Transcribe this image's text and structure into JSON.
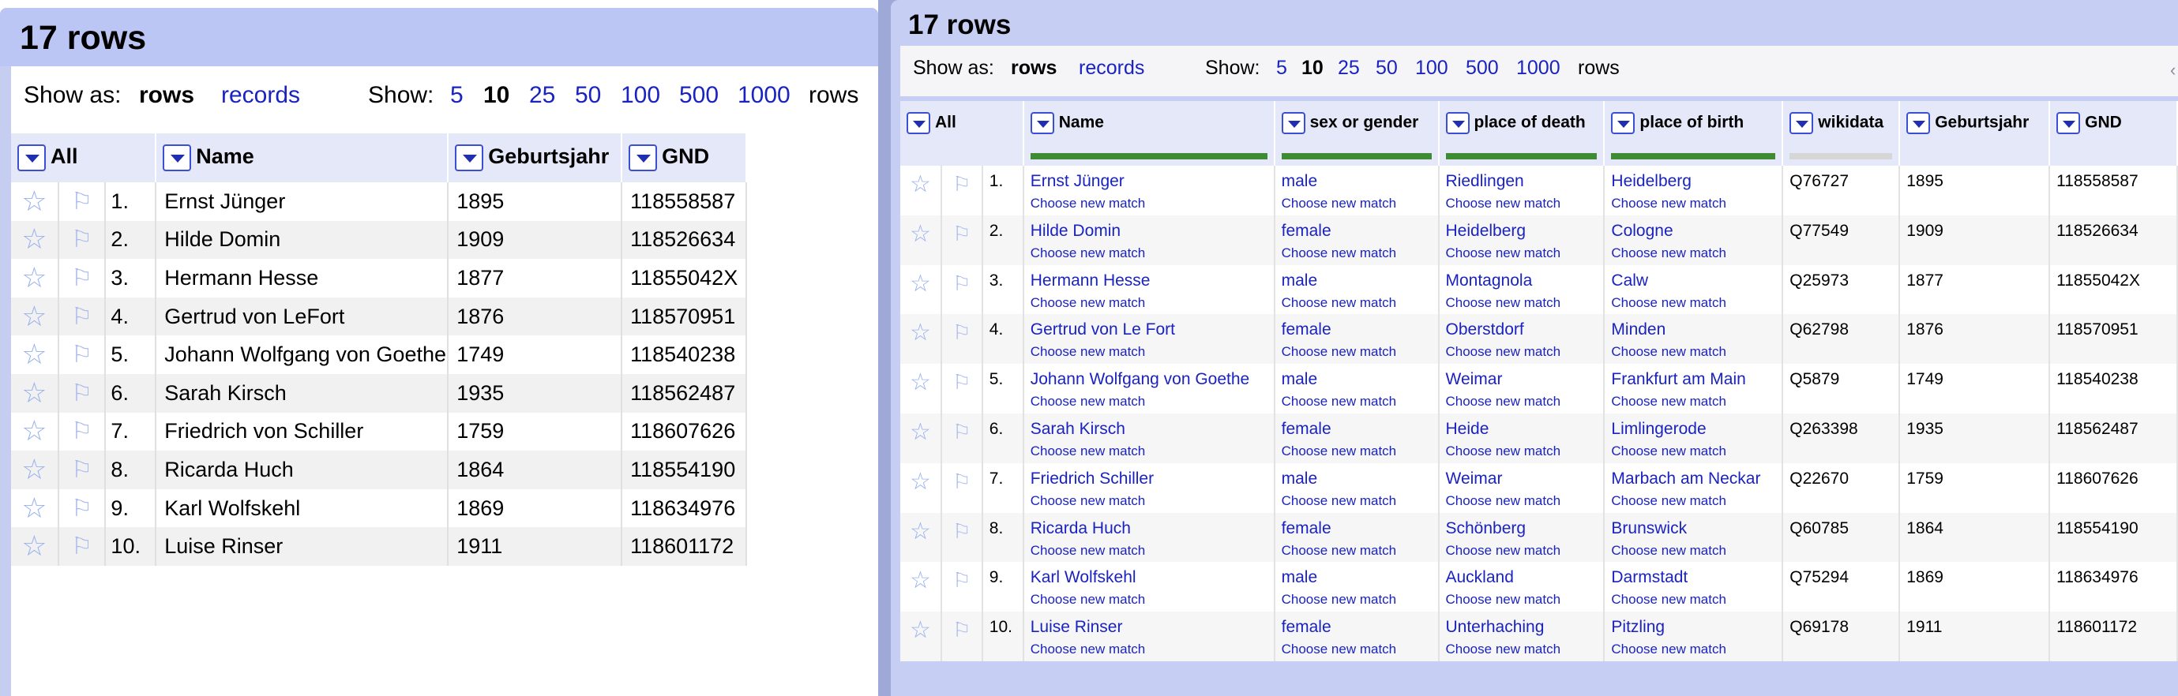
{
  "left": {
    "title": "17 rows",
    "show_as_label": "Show as:",
    "view_rows": "rows",
    "view_records": "records",
    "show_label": "Show:",
    "page_sizes": [
      "5",
      "10",
      "25",
      "50",
      "100",
      "500",
      "1000"
    ],
    "selected_page_size": "10",
    "rows_suffix": "rows",
    "columns": [
      "All",
      "Name",
      "Geburtsjahr",
      "GND"
    ],
    "rows": [
      {
        "n": "1.",
        "name": "Ernst Jünger",
        "year": "1895",
        "gnd": "118558587"
      },
      {
        "n": "2.",
        "name": "Hilde Domin",
        "year": "1909",
        "gnd": "118526634"
      },
      {
        "n": "3.",
        "name": "Hermann Hesse",
        "year": "1877",
        "gnd": "11855042X"
      },
      {
        "n": "4.",
        "name": "Gertrud von LeFort",
        "year": "1876",
        "gnd": "118570951"
      },
      {
        "n": "5.",
        "name": "Johann Wolfgang von Goethe",
        "year": "1749",
        "gnd": "118540238"
      },
      {
        "n": "6.",
        "name": "Sarah Kirsch",
        "year": "1935",
        "gnd": "118562487"
      },
      {
        "n": "7.",
        "name": "Friedrich von Schiller",
        "year": "1759",
        "gnd": "118607626"
      },
      {
        "n": "8.",
        "name": "Ricarda Huch",
        "year": "1864",
        "gnd": "118554190"
      },
      {
        "n": "9.",
        "name": "Karl Wolfskehl",
        "year": "1869",
        "gnd": "118634976"
      },
      {
        "n": "10.",
        "name": "Luise Rinser",
        "year": "1911",
        "gnd": "118601172"
      }
    ]
  },
  "right": {
    "title": "17 rows",
    "show_as_label": "Show as:",
    "view_rows": "rows",
    "view_records": "records",
    "show_label": "Show:",
    "page_sizes": [
      "5",
      "10",
      "25",
      "50",
      "100",
      "500",
      "1000"
    ],
    "selected_page_size": "10",
    "rows_suffix": "rows",
    "columns": [
      "All",
      "Name",
      "sex or gender",
      "place of death",
      "place of birth",
      "wikidata",
      "Geburtsjahr",
      "GND"
    ],
    "choose_label": "Choose new match",
    "rows": [
      {
        "n": "1.",
        "name": "Ernst Jünger",
        "sex": "male",
        "death": "Riedlingen",
        "birth": "Heidelberg",
        "wd": "Q76727",
        "year": "1895",
        "gnd": "118558587"
      },
      {
        "n": "2.",
        "name": "Hilde Domin",
        "sex": "female",
        "death": "Heidelberg",
        "birth": "Cologne",
        "wd": "Q77549",
        "year": "1909",
        "gnd": "118526634"
      },
      {
        "n": "3.",
        "name": "Hermann Hesse",
        "sex": "male",
        "death": "Montagnola",
        "birth": "Calw",
        "wd": "Q25973",
        "year": "1877",
        "gnd": "11855042X"
      },
      {
        "n": "4.",
        "name": "Gertrud von Le Fort",
        "sex": "female",
        "death": "Oberstdorf",
        "birth": "Minden",
        "wd": "Q62798",
        "year": "1876",
        "gnd": "118570951"
      },
      {
        "n": "5.",
        "name": "Johann Wolfgang von Goethe",
        "sex": "male",
        "death": "Weimar",
        "birth": "Frankfurt am Main",
        "wd": "Q5879",
        "year": "1749",
        "gnd": "118540238"
      },
      {
        "n": "6.",
        "name": "Sarah Kirsch",
        "sex": "female",
        "death": "Heide",
        "birth": "Limlingerode",
        "wd": "Q263398",
        "year": "1935",
        "gnd": "118562487"
      },
      {
        "n": "7.",
        "name": "Friedrich Schiller",
        "sex": "male",
        "death": "Weimar",
        "birth": "Marbach am Neckar",
        "wd": "Q22670",
        "year": "1759",
        "gnd": "118607626"
      },
      {
        "n": "8.",
        "name": "Ricarda Huch",
        "sex": "female",
        "death": "Schönberg",
        "birth": "Brunswick",
        "wd": "Q60785",
        "year": "1864",
        "gnd": "118554190"
      },
      {
        "n": "9.",
        "name": "Karl Wolfskehl",
        "sex": "male",
        "death": "Auckland",
        "birth": "Darmstadt",
        "wd": "Q75294",
        "year": "1869",
        "gnd": "118634976"
      },
      {
        "n": "10.",
        "name": "Luise Rinser",
        "sex": "female",
        "death": "Unterhaching",
        "birth": "Pitzling",
        "wd": "Q69178",
        "year": "1911",
        "gnd": "118601172"
      }
    ]
  },
  "colors": {
    "header_band": "#bcc6f5",
    "link": "#1a23bf",
    "recon_bar": "#3f8b33"
  }
}
